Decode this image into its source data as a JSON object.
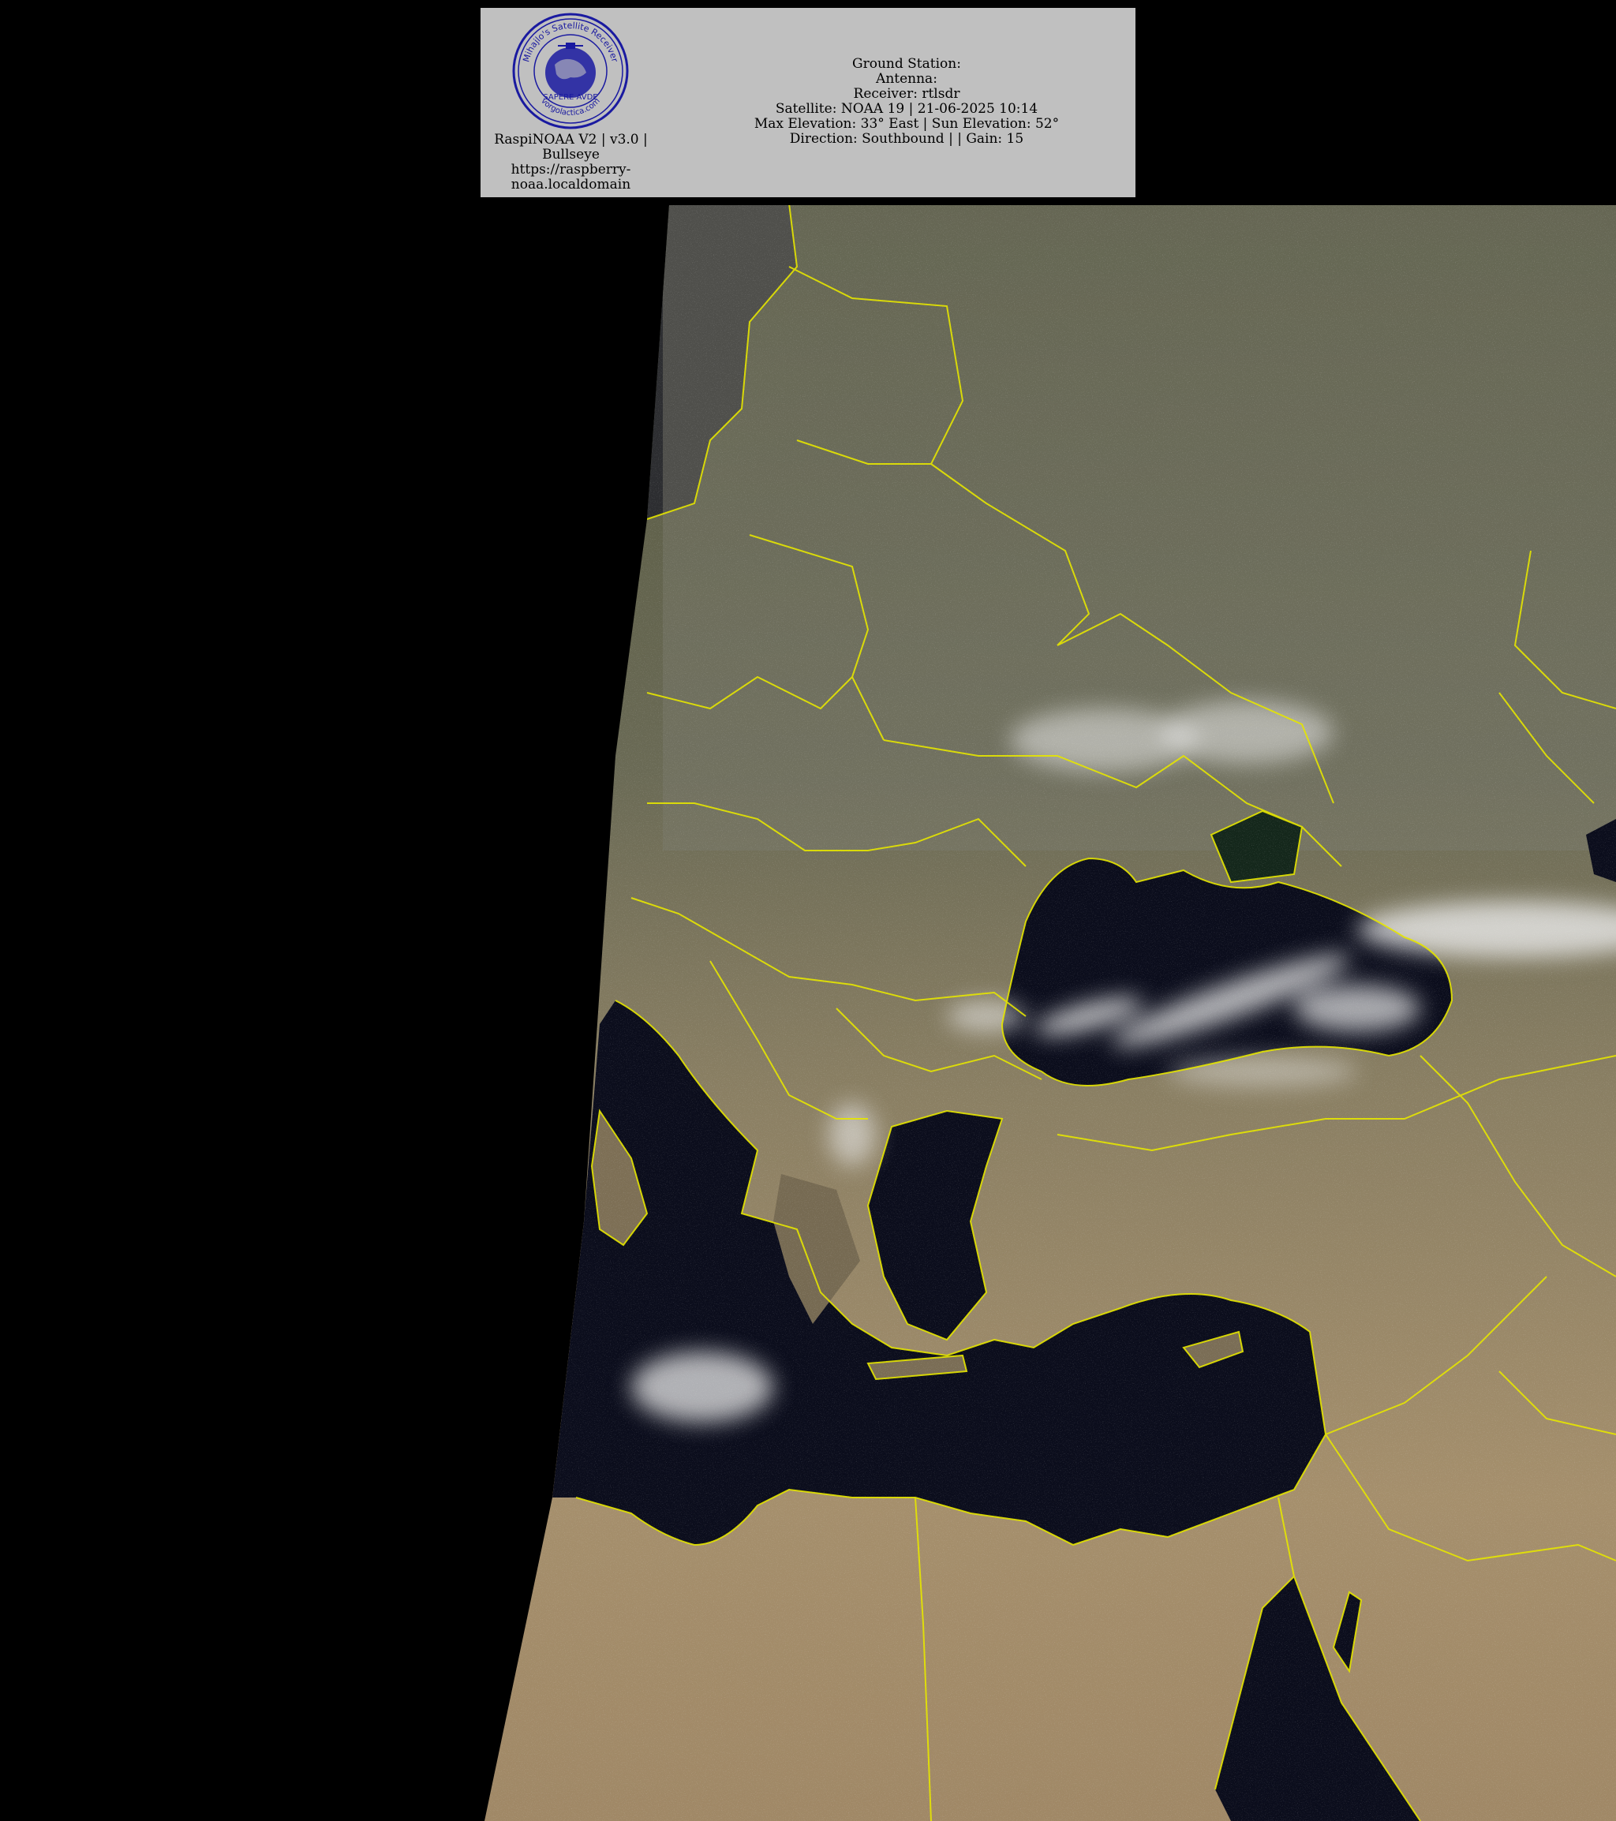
{
  "logo": {
    "ring_top_text": "Mihajlo's Satellite Receiver",
    "ring_bottom_text": "vorgolactica.com",
    "band_text": "SAPERE AVDE",
    "color": "#1a1aa0"
  },
  "software": {
    "line1": "RaspiNOAA V2 | v3.0 |",
    "line2": "Bullseye",
    "line3": "https://raspberry-",
    "line4": "noaa.localdomain"
  },
  "pass_info": {
    "ground_station": "Ground Station:",
    "antenna": "Antenna:",
    "receiver": "Receiver: rtlsdr",
    "satellite": "Satellite: NOAA 19 | 21-06-2025 10:14",
    "elevation": "Max Elevation: 33° East | Sun Elevation: 52°",
    "direction": "Direction: Southbound | | Gain: 15"
  },
  "colors": {
    "header_bg": "#c0c0c0",
    "page_bg": "#000000",
    "border_lines": "#e6e600",
    "sea": "#0b0d1c",
    "land_north": "#56573f",
    "land_south": "#a08c6a",
    "cloud": "#e8e8e8"
  }
}
